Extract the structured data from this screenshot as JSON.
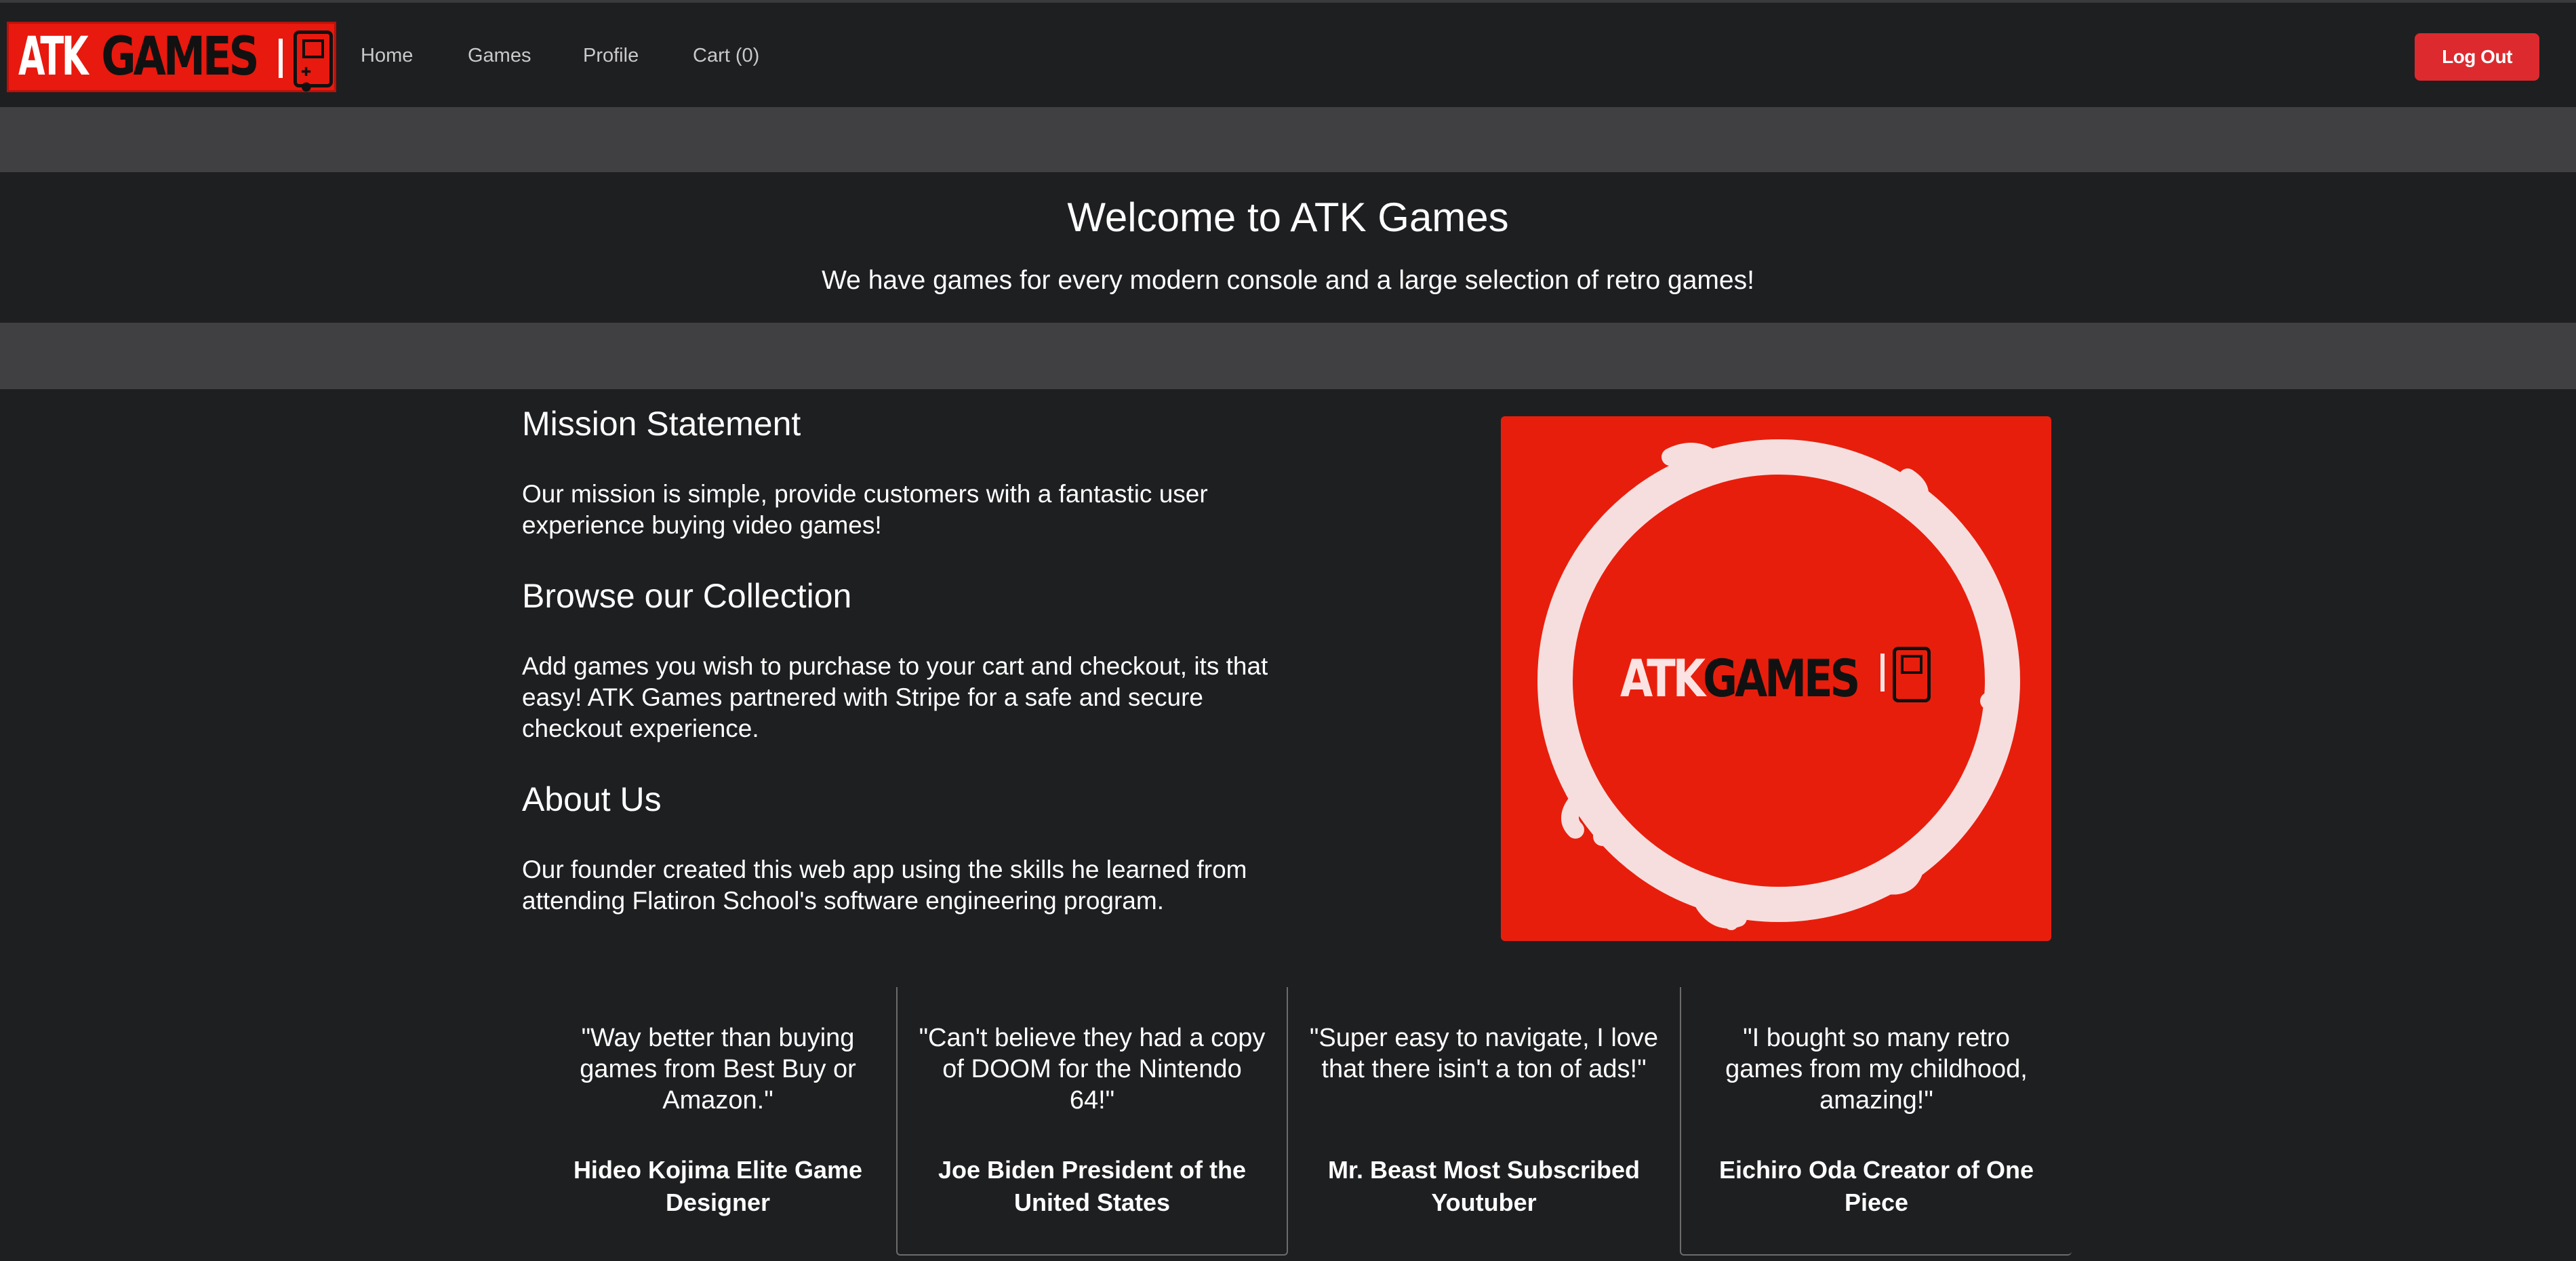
{
  "navbar": {
    "logo": {
      "atk": "ATK",
      "games": "GAMES"
    },
    "links": {
      "home": "Home",
      "games": "Games",
      "profile": "Profile",
      "cart": "Cart (0)"
    },
    "logout_label": "Log Out"
  },
  "welcome": {
    "title": "Welcome to ATK Games",
    "subtitle": "We have games for every modern console and a large selection of retro games!"
  },
  "sections": {
    "mission": {
      "heading": "Mission Statement",
      "body": "Our mission is simple, provide customers with a fantastic user experience buying video games!"
    },
    "browse": {
      "heading": "Browse our Collection",
      "body": "Add games you wish to purchase to your cart and checkout, its that easy! ATK Games partnered with Stripe for a safe and secure checkout experience."
    },
    "about": {
      "heading": "About Us",
      "body": "Our founder created this web app using the skills he learned from attending Flatiron School's software engineering program."
    }
  },
  "hero_image": {
    "logo": {
      "atk": "ATK",
      "games": "GAMES"
    }
  },
  "testimonials": [
    {
      "quote": "\"Way better than buying games from Best Buy or Amazon.\"",
      "author": "Hideo Kojima Elite Game Designer"
    },
    {
      "quote": "\"Can't believe they had a copy of DOOM for the Nintendo 64!\"",
      "author": "Joe Biden President of the United States"
    },
    {
      "quote": "\"Super easy to navigate, I love that there isin't a ton of ads!\"",
      "author": "Mr. Beast Most Subscribed Youtuber"
    },
    {
      "quote": "\"I bought so many retro games from my childhood, amazing!\"",
      "author": "Eichiro Oda Creator of One Piece"
    }
  ],
  "colors": {
    "background": "#1e1f21",
    "band": "#403f41",
    "brand_red": "#e8190e",
    "logout_red": "#dc2a2f"
  },
  "icons": {
    "logo_device": "handheld-console-icon"
  }
}
